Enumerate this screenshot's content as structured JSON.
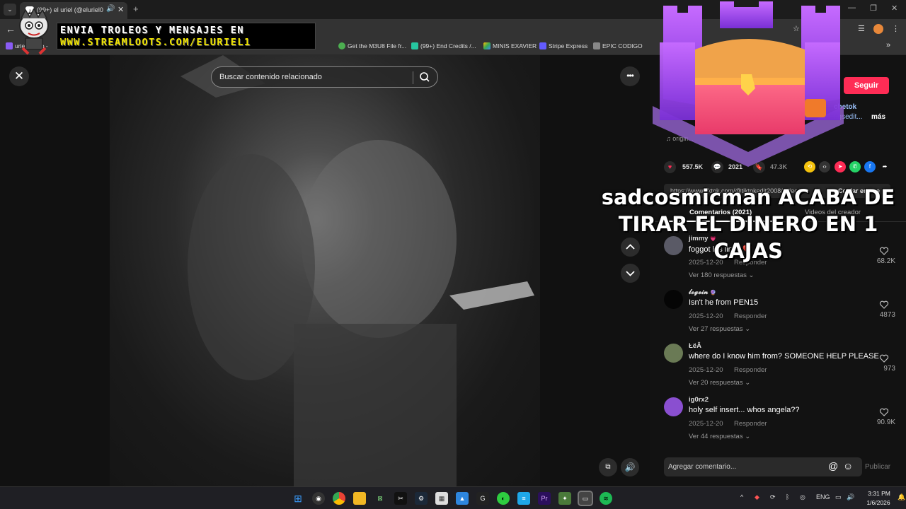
{
  "browser": {
    "tab_title": "(99+) el uriel (@eluriel0",
    "new_tab": "+",
    "bookmarks": [
      {
        "label": "urie... ...ico -",
        "color": "#8a5cf5"
      },
      {
        "label": "Get the M3U8 File fr...",
        "color": "#4caf50"
      },
      {
        "label": "(99+) End Credits /...",
        "color": "#26c6a0"
      },
      {
        "label": "MINIS EXAVIER",
        "color": "#fbbc04"
      },
      {
        "label": "Stripe Express",
        "color": "#635bff"
      },
      {
        "label": "EPIC CODIGO",
        "color": "#888888"
      }
    ],
    "bookmarks_overflow": "»"
  },
  "overlay": {
    "banner_line1": "ENVIA TROLEOS Y MENSAJES EN",
    "banner_line2": "WWW.STREAMLOOTS.COM/ELURIEL1",
    "alert": "sadcosmicman ACABA DE TIRAR EL DINERO EN 1 CAJAS"
  },
  "video": {
    "search_placeholder": "Buscar contenido relacionado",
    "close_glyph": "✕",
    "more_glyph": "•••"
  },
  "panel": {
    "follow_label": "Seguir",
    "desc_tag1": "chetok",
    "desc_tag2": "ngsedit...",
    "more_label": "más",
    "music": "♫ origin...",
    "likes": "557.5K",
    "comments_count": "2021",
    "saves": "47.3K",
    "link": "https://www.tiktok.com/@tiktokedit2008/video/7...",
    "copy_link": "Copiar enlace",
    "tab_comments": "Comentarios (2021)",
    "tab_creator": "Videos del creador",
    "comments": [
      {
        "user": "jimmy",
        "badge": "💗",
        "text": "foggot his lines 💔",
        "date": "2025-12-20",
        "reply": "Responder",
        "replies": "Ver 180 respuestas ⌄",
        "likes": "68.2K",
        "avatar": "#5a5a66"
      },
      {
        "user": "𝓵𝓸𝓰𝓮𝓲𝓷",
        "badge": "🔮",
        "text": "Isn't he from PEN15",
        "date": "2025-12-20",
        "reply": "Responder",
        "replies": "Ver 27 respuestas ⌄",
        "likes": "4873",
        "avatar": "#050505"
      },
      {
        "user": "ŁëÂ",
        "badge": "",
        "text": "where do I know him from? SOMEONE HELP PLEASE",
        "date": "2025-12-20",
        "reply": "Responder",
        "replies": "Ver 20 respuestas ⌄",
        "likes": "973",
        "avatar": "#6a7a55"
      },
      {
        "user": "ig0rx2",
        "badge": "",
        "text": "holy self insert... whos angela??",
        "date": "2025-12-20",
        "reply": "Responder",
        "replies": "Ver 44 respuestas ⌄",
        "likes": "90.9K",
        "avatar": "#8a4fd0"
      }
    ],
    "comment_placeholder": "Agregar comentario...",
    "publish_label": "Publicar"
  },
  "taskbar": {
    "lang": "ENG",
    "time": "3:31 PM",
    "date": "1/6/2026"
  },
  "colors": {
    "accent": "#fe2c55",
    "banner_yellow": "#f2e600"
  }
}
